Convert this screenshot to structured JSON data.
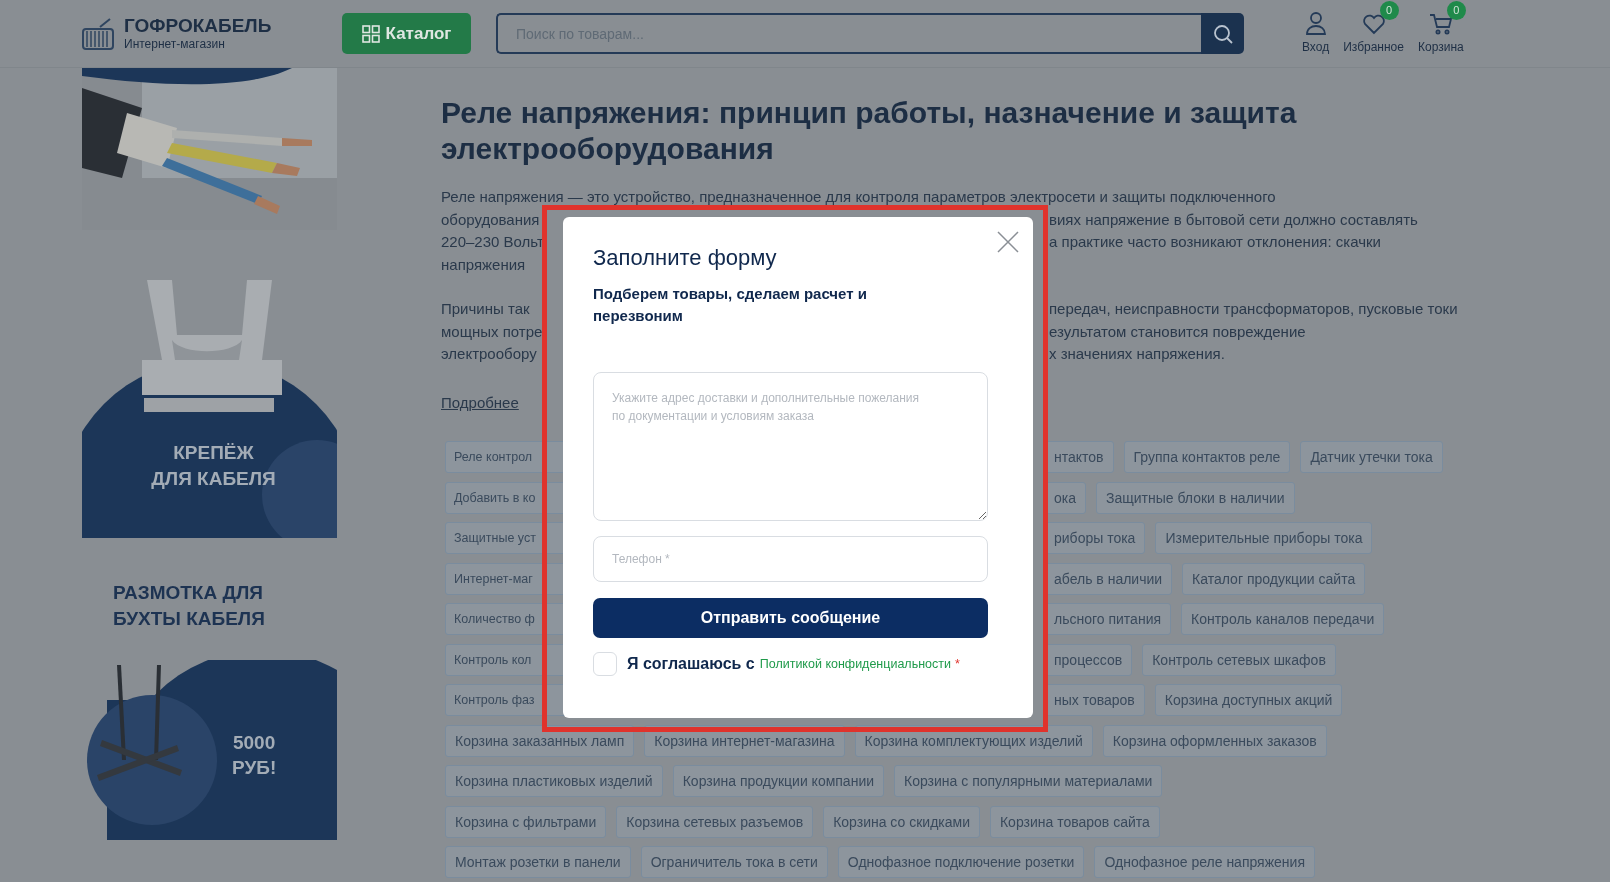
{
  "header": {
    "logo": {
      "title": "ГОФРОКАБЕЛЬ",
      "subtitle": "Интернет-магазин"
    },
    "catalog_button": "Каталог",
    "search": {
      "placeholder": "Поиск по товарам..."
    },
    "actions": [
      {
        "kind": "user",
        "label": "Вход"
      },
      {
        "kind": "favorites",
        "label": "Избранное",
        "badge": "0"
      },
      {
        "kind": "cart",
        "label": "Корзина",
        "badge": "0"
      }
    ]
  },
  "sidebar": {
    "fastener_banner": {
      "caption_lines": [
        "КРЕПЁЖ",
        "ДЛЯ КАБЕЛЯ"
      ]
    },
    "promo_heading_lines": [
      "РАЗМОТКА ДЛЯ",
      "БУХТЫ КАБЕЛЯ"
    ],
    "reel_banner": {
      "price_lines": [
        "5000",
        "РУБ!"
      ]
    }
  },
  "article": {
    "title": "Реле напряжения: принцип работы, назначение и защита электрооборудования",
    "paragraphs": [
      {
        "lines": [
          {
            "left": "Реле напряжения — это устройство, предназначенное для контроля параметров электросети и защиты подключенного"
          },
          {
            "left": "оборудования",
            "right": "виях напряжение в бытовой сети должно составлять"
          },
          {
            "left": "220–230 Вольт",
            "right": "а практике часто возникают отклонения: скачки"
          },
          {
            "left": "напряжения"
          }
        ]
      },
      {
        "lines": [
          {
            "left": "Причины так",
            "right": "передач, неисправности трансформаторов, пусковые токи"
          },
          {
            "left": "мощных потре",
            "right": "езультатом становится повреждение"
          },
          {
            "left": "электрообору",
            "right": "х значениях напряжения."
          }
        ]
      }
    ],
    "more_link": "Подробнее",
    "tag_rows": [
      {
        "left": [
          "Реле контрол"
        ],
        "right": [
          "нтактов",
          "Группа контактов реле",
          "Датчик утечки тока"
        ]
      },
      {
        "left": [
          "Добавить в ко"
        ],
        "right": [
          "ока",
          "Защитные блоки в наличии"
        ]
      },
      {
        "left": [
          "Защитные уст"
        ],
        "right": [
          "риборы тока",
          "Измерительные приборы тока"
        ]
      },
      {
        "left": [
          "Интернет-маг"
        ],
        "right": [
          "абель в наличии",
          "Каталог продукции сайта"
        ]
      },
      {
        "left": [
          "Количество ф"
        ],
        "right": [
          "льсного питания",
          "Контроль каналов передачи"
        ]
      },
      {
        "left": [
          "Контроль кол"
        ],
        "right": [
          "процессов",
          "Контроль сетевых шкафов"
        ]
      },
      {
        "left": [
          "Контроль фаз"
        ],
        "right": [
          "ных товаров",
          "Корзина доступных акций"
        ]
      },
      {
        "left": [
          "Корзина заказанных ламп",
          "Корзина интернет-магазина",
          "Корзина комплектующих изделий",
          "Корзина оформленных заказов"
        ]
      },
      {
        "left": [
          "Корзина пластиковых изделий",
          "Корзина продукции компании",
          "Корзина с популярными материалами"
        ]
      },
      {
        "left": [
          "Корзина с фильтрами",
          "Корзина сетевых разъемов",
          "Корзина со скидками",
          "Корзина товаров сайта"
        ]
      },
      {
        "left": [
          "Монтаж розетки в панели",
          "Ограничитель тока в сети",
          "Однофазное подключение розетки",
          "Однофазное реле напряжения"
        ]
      }
    ]
  },
  "modal": {
    "title": "Заполните форму",
    "subtitle": "Подберем товары, сделаем расчет и перезвоним",
    "comment_field": {
      "placeholder": "Укажите адрес доставки и дополнительные пожелания по документации и условиям заказа"
    },
    "phone_field": {
      "placeholder": "Телефон *"
    },
    "submit": "Отправить сообщение",
    "consent": {
      "checked": false,
      "text": "Я соглашаюсь с",
      "link": "Политикой конфиденциальности",
      "required_mark": "*"
    }
  }
}
